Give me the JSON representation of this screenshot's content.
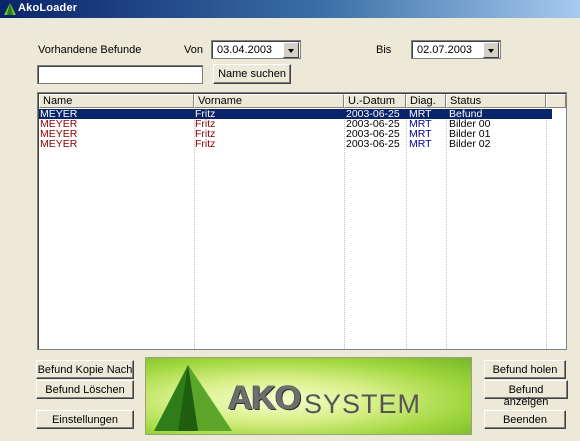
{
  "window": {
    "title": "AkoLoader",
    "accent": "#0a246a"
  },
  "filter": {
    "label": "Vorhandene Befunde",
    "von_label": "Von",
    "von_value": "03.04.2003",
    "bis_label": "Bis",
    "bis_value": "02.07.2003",
    "search_value": "",
    "search_button": "Name suchen"
  },
  "table": {
    "columns": [
      "Name",
      "Vorname",
      "U.-Datum",
      "Diag.",
      "Status"
    ],
    "rows": [
      {
        "name": "MEYER",
        "vorname": "Fritz",
        "datum": "2003-06-25",
        "diag": "MRT",
        "status": "Befund",
        "selected": true
      },
      {
        "name": "MEYER",
        "vorname": "Fritz",
        "datum": "2003-06-25",
        "diag": "MRT",
        "status": "Bilder 00",
        "selected": false
      },
      {
        "name": "MEYER",
        "vorname": "Fritz",
        "datum": "2003-06-25",
        "diag": "MRT",
        "status": "Bilder 01",
        "selected": false
      },
      {
        "name": "MEYER",
        "vorname": "Fritz",
        "datum": "2003-06-25",
        "diag": "MRT",
        "status": "Bilder 02",
        "selected": false
      }
    ]
  },
  "buttons": {
    "kopie": "Befund Kopie Nach",
    "loeschen": "Befund Löschen",
    "einstellungen": "Einstellungen",
    "holen": "Befund holen",
    "anzeigen": "Befund anzeigen",
    "beenden": "Beenden"
  },
  "logo": {
    "ako": "AKO",
    "system": "SYSTEM"
  }
}
